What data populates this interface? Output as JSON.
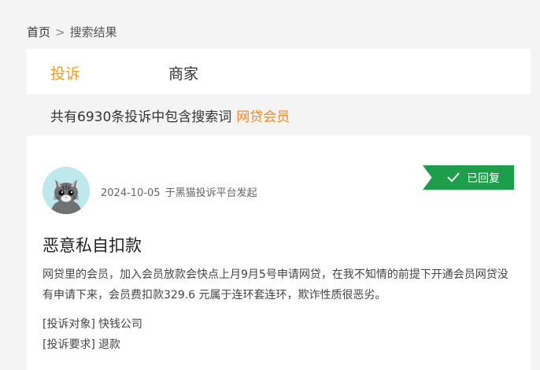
{
  "breadcrumb": {
    "home": "首页",
    "separator": ">",
    "current": "搜索结果"
  },
  "tabs": [
    {
      "label": "投诉",
      "active": true
    },
    {
      "label": "商家",
      "active": false
    }
  ],
  "summary": {
    "text": "共有6930条投诉中包含搜索词",
    "keyword": "网贷会员"
  },
  "complaint": {
    "date": "2024-10-05",
    "platform": "于黑猫投诉平台发起",
    "status": "已回复",
    "status_color": "#1e9e4a",
    "title": "恶意私自扣款",
    "description": "网贷里的会员，加入会员放款会快点上月9月5号申请网贷，在我不知情的前提下开通会员网贷没有申请下来，会员费扣款329.6 元属于连环套连环，欺诈性质很恶劣。",
    "target_label": "[投诉对象]",
    "target_value": "快钱公司",
    "request_label": "[投诉要求]",
    "request_value": "退款"
  },
  "colors": {
    "accent": "#f0a020",
    "keyword": "#f08a24",
    "page_bg": "#f4f4f4"
  },
  "icons": {
    "avatar": "cat-avatar-icon",
    "status": "check-icon"
  }
}
